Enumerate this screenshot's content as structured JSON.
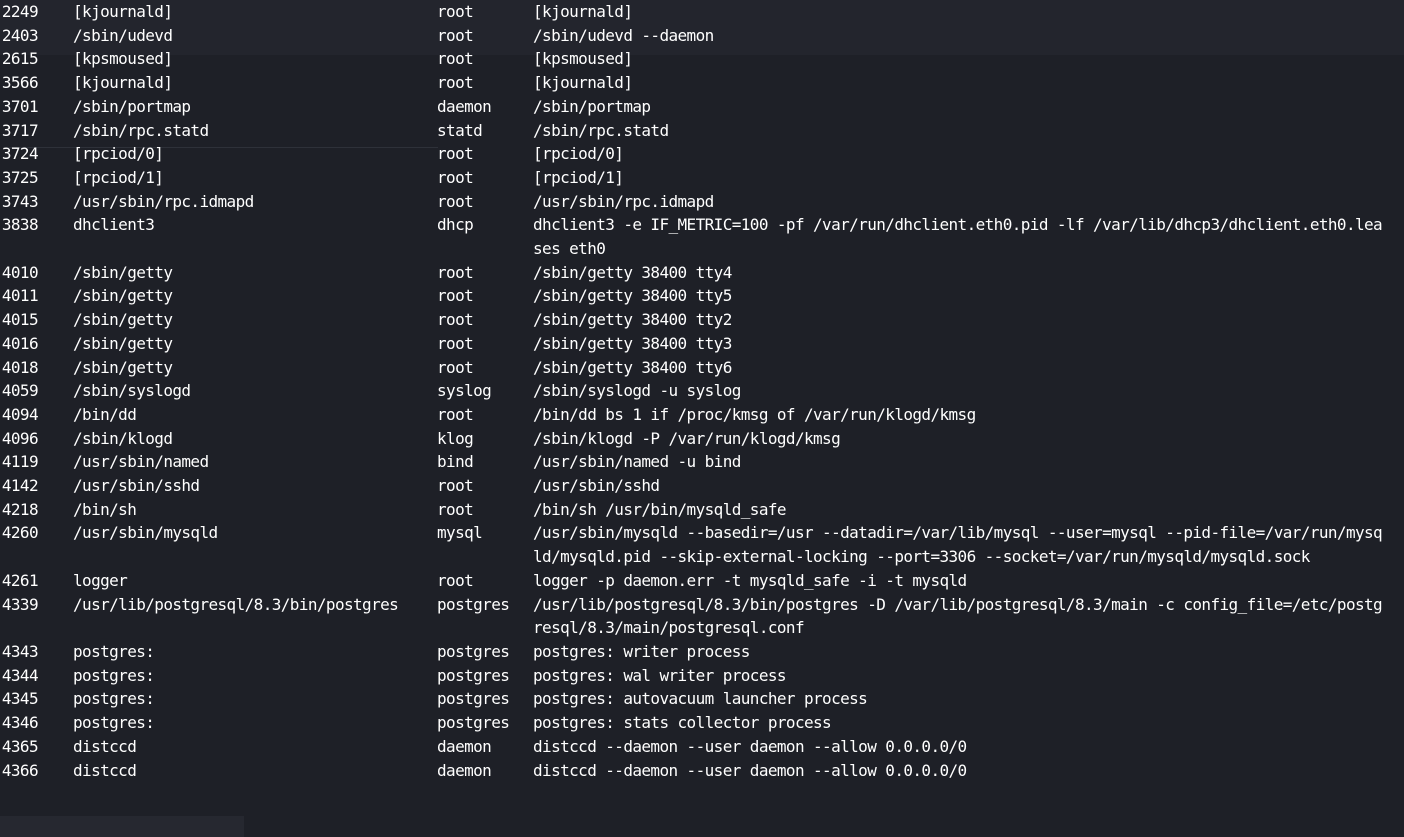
{
  "processes": [
    {
      "pid": "2249",
      "name": "[kjournald]",
      "user": "root",
      "cmd": "[kjournald]"
    },
    {
      "pid": "2403",
      "name": "/sbin/udevd",
      "user": "root",
      "cmd": "/sbin/udevd --daemon"
    },
    {
      "pid": "2615",
      "name": "[kpsmoused]",
      "user": "root",
      "cmd": "[kpsmoused]"
    },
    {
      "pid": "3566",
      "name": "[kjournald]",
      "user": "root",
      "cmd": "[kjournald]"
    },
    {
      "pid": "3701",
      "name": "/sbin/portmap",
      "user": "daemon",
      "cmd": "/sbin/portmap"
    },
    {
      "pid": "3717",
      "name": "/sbin/rpc.statd",
      "user": "statd",
      "cmd": "/sbin/rpc.statd"
    },
    {
      "pid": "3724",
      "name": "[rpciod/0]",
      "user": "root",
      "cmd": "[rpciod/0]"
    },
    {
      "pid": "3725",
      "name": "[rpciod/1]",
      "user": "root",
      "cmd": "[rpciod/1]"
    },
    {
      "pid": "3743",
      "name": "/usr/sbin/rpc.idmapd",
      "user": "root",
      "cmd": "/usr/sbin/rpc.idmapd"
    },
    {
      "pid": "3838",
      "name": "dhclient3",
      "user": "dhcp",
      "cmd": "dhclient3 -e IF_METRIC=100 -pf /var/run/dhclient.eth0.pid -lf /var/lib/dhcp3/dhclient.eth0.leases eth0"
    },
    {
      "pid": "4010",
      "name": "/sbin/getty",
      "user": "root",
      "cmd": "/sbin/getty 38400 tty4"
    },
    {
      "pid": "4011",
      "name": "/sbin/getty",
      "user": "root",
      "cmd": "/sbin/getty 38400 tty5"
    },
    {
      "pid": "4015",
      "name": "/sbin/getty",
      "user": "root",
      "cmd": "/sbin/getty 38400 tty2"
    },
    {
      "pid": "4016",
      "name": "/sbin/getty",
      "user": "root",
      "cmd": "/sbin/getty 38400 tty3"
    },
    {
      "pid": "4018",
      "name": "/sbin/getty",
      "user": "root",
      "cmd": "/sbin/getty 38400 tty6"
    },
    {
      "pid": "4059",
      "name": "/sbin/syslogd",
      "user": "syslog",
      "cmd": "/sbin/syslogd -u syslog"
    },
    {
      "pid": "4094",
      "name": "/bin/dd",
      "user": "root",
      "cmd": "/bin/dd bs 1 if /proc/kmsg of /var/run/klogd/kmsg"
    },
    {
      "pid": "4096",
      "name": "/sbin/klogd",
      "user": "klog",
      "cmd": "/sbin/klogd -P /var/run/klogd/kmsg"
    },
    {
      "pid": "4119",
      "name": "/usr/sbin/named",
      "user": "bind",
      "cmd": "/usr/sbin/named -u bind"
    },
    {
      "pid": "4142",
      "name": "/usr/sbin/sshd",
      "user": "root",
      "cmd": "/usr/sbin/sshd"
    },
    {
      "pid": "4218",
      "name": "/bin/sh",
      "user": "root",
      "cmd": "/bin/sh /usr/bin/mysqld_safe"
    },
    {
      "pid": "4260",
      "name": "/usr/sbin/mysqld",
      "user": "mysql",
      "cmd": "/usr/sbin/mysqld --basedir=/usr --datadir=/var/lib/mysql --user=mysql --pid-file=/var/run/mysqld/mysqld.pid --skip-external-locking --port=3306 --socket=/var/run/mysqld/mysqld.sock"
    },
    {
      "pid": "4261",
      "name": "logger",
      "user": "root",
      "cmd": "logger -p daemon.err -t mysqld_safe -i -t mysqld"
    },
    {
      "pid": "4339",
      "name": "/usr/lib/postgresql/8.3/bin/postgres",
      "user": "postgres",
      "cmd": "/usr/lib/postgresql/8.3/bin/postgres -D /var/lib/postgresql/8.3/main -c config_file=/etc/postgresql/8.3/main/postgresql.conf"
    },
    {
      "pid": "4343",
      "name": "postgres:",
      "user": "postgres",
      "cmd": "postgres: writer process"
    },
    {
      "pid": "4344",
      "name": "postgres:",
      "user": "postgres",
      "cmd": "postgres: wal writer process"
    },
    {
      "pid": "4345",
      "name": "postgres:",
      "user": "postgres",
      "cmd": "postgres: autovacuum launcher process"
    },
    {
      "pid": "4346",
      "name": "postgres:",
      "user": "postgres",
      "cmd": "postgres: stats collector process"
    },
    {
      "pid": "4365",
      "name": "distccd",
      "user": "daemon",
      "cmd": "distccd --daemon --user daemon --allow 0.0.0.0/0"
    },
    {
      "pid": "4366",
      "name": "distccd",
      "user": "daemon",
      "cmd": "distccd --daemon --user daemon --allow 0.0.0.0/0"
    }
  ]
}
